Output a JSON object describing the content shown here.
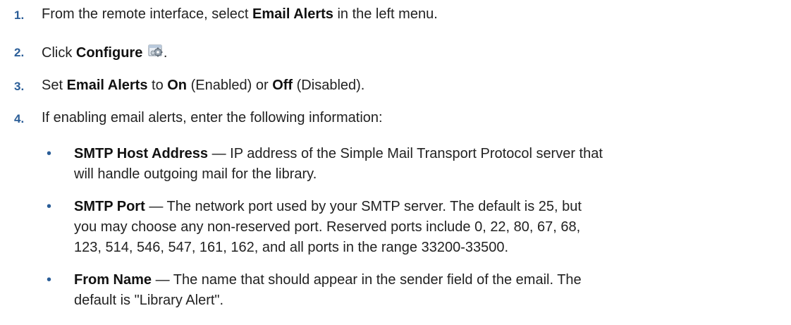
{
  "steps": [
    {
      "number": "1.",
      "pre": "From the remote interface, select ",
      "bold1": "Email Alerts",
      "post": " in the left menu."
    },
    {
      "number": "2.",
      "pre": "Click ",
      "bold1": "Configure",
      "post": "."
    },
    {
      "number": "3.",
      "pre": "Set ",
      "bold1": "Email Alerts",
      "mid1": " to ",
      "bold2": "On",
      "mid2": " (Enabled) or ",
      "bold3": "Off",
      "post": " (Disabled)."
    },
    {
      "number": "4.",
      "text": "If enabling email alerts, enter the following information:"
    }
  ],
  "bullets": [
    {
      "term": "SMTP Host Address",
      "line1": " — IP address of the Simple Mail Transport Protocol server that",
      "line2": "will handle outgoing mail for the library."
    },
    {
      "term": "SMTP Port",
      "line1": " — The network port used by your SMTP server. The default is 25, but",
      "line2": "you may choose any non-reserved port. Reserved ports include 0, 22, 80, 67, 68,",
      "line3": "123, 514, 546, 547, 161, 162, and all ports in the range 33200-33500."
    },
    {
      "term": "From Name",
      "line1": " — The name that should appear in the sender field of the email. The",
      "line2": "default is \"Library Alert\"."
    }
  ],
  "bullet_glyph": "•",
  "icons": {
    "configure": "configure-settings-icon"
  },
  "colors": {
    "step_number": "#2a5d97",
    "text": "#222222"
  }
}
